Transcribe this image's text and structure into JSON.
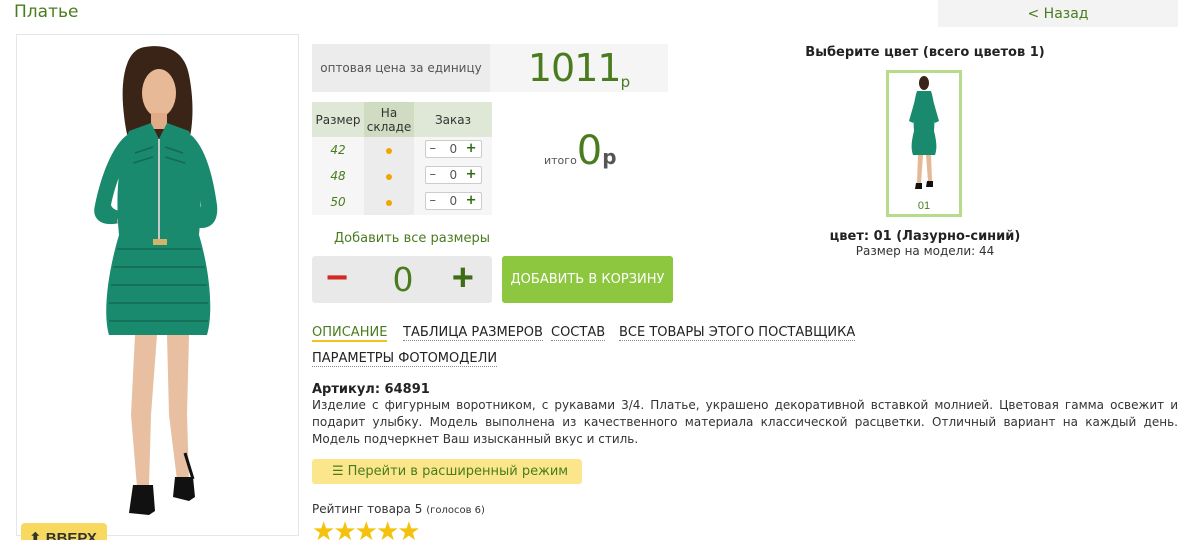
{
  "page": {
    "title": "Платье",
    "back_label": "< Назад",
    "up_label": "ВВЕРХ",
    "up_icon": "arrow-up-icon"
  },
  "price": {
    "label": "оптовая цена за единицу",
    "value": "1011",
    "currency": "р"
  },
  "size_table": {
    "headers": [
      "Размер",
      "На складе",
      "Заказ"
    ],
    "rows": [
      {
        "size": "42",
        "in_stock": true,
        "qty": "0"
      },
      {
        "size": "48",
        "in_stock": true,
        "qty": "0"
      },
      {
        "size": "50",
        "in_stock": true,
        "qty": "0"
      }
    ],
    "stepper_minus": "–",
    "stepper_plus": "+"
  },
  "total": {
    "label": "итого",
    "value": "0",
    "currency": "р"
  },
  "order": {
    "add_all_label": "Добавить все размеры",
    "quantity": "0",
    "minus": "−",
    "plus": "+",
    "cart_label": "ДОБАВИТЬ В КОРЗИНУ"
  },
  "tabs": [
    {
      "label": "ОПИСАНИЕ",
      "active": true
    },
    {
      "label": "ТАБЛИЦА РАЗМЕРОВ",
      "active": false
    },
    {
      "label": "СОСТАВ",
      "active": false
    },
    {
      "label": "ВСЕ ТОВАРЫ ЭТОГО ПОСТАВЩИКА",
      "active": false
    },
    {
      "label": "ПАРАМЕТРЫ ФОТОМОДЕЛИ",
      "active": false
    }
  ],
  "description": {
    "article": "Артикул: 64891",
    "text": "Изделие с фигурным воротником, с рукавами 3/4. Платье, украшено декоративной вставкой молнией. Цветовая гамма освежит и подарит улыбку. Модель выполнена из качественного материала классической расцветки. Отличный вариант на каждый день. Модель подчеркнет Ваш изысканный вкус и стиль."
  },
  "advanced": {
    "label": "Перейти в расширенный режим",
    "icon": "list-icon"
  },
  "rating": {
    "label": "Рейтинг товара 5",
    "votes": "(голосов 6)",
    "stars": 5
  },
  "colors": {
    "title": "Выберите цвет (всего цветов 1)",
    "swatch_label": "01",
    "selected": "цвет: 01 (Лазурно-синий)",
    "model_size": "Размер на модели: 44"
  },
  "theme": {
    "accent_green": "#4a7c1f",
    "button_green": "#8dc63f",
    "dress_color": "#1a8a6e",
    "star_color": "#f4c20d"
  }
}
